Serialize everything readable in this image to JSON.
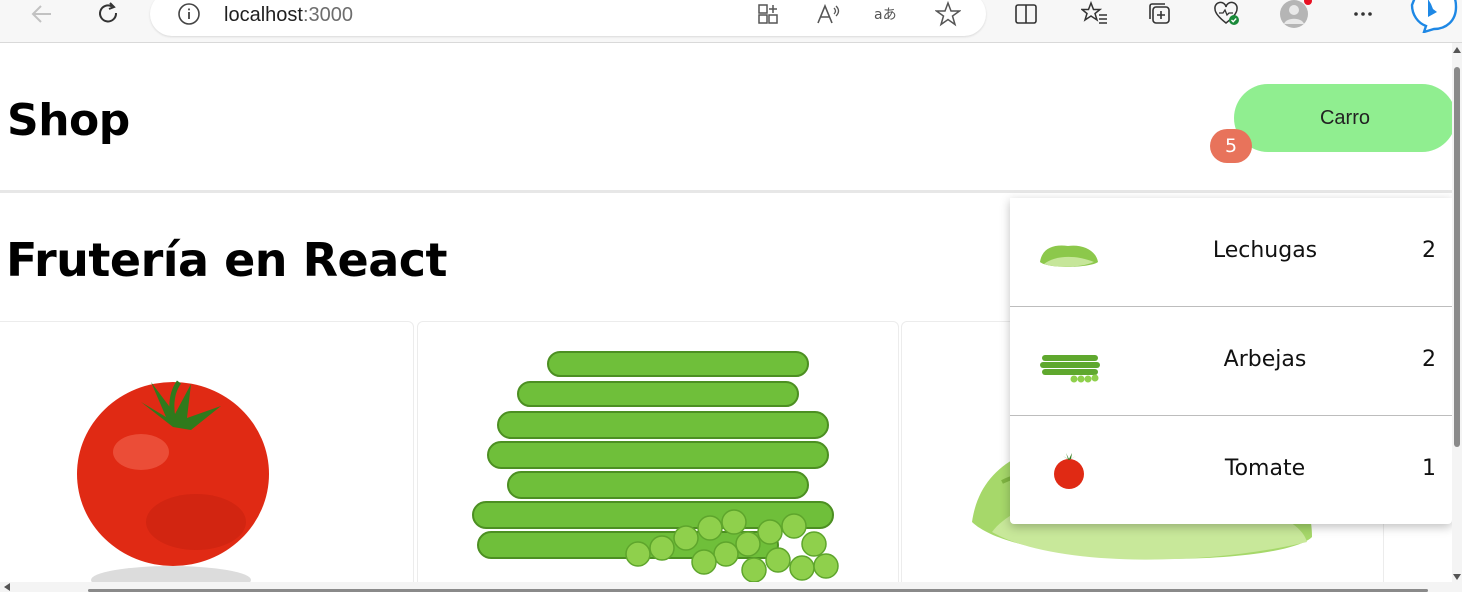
{
  "browser": {
    "url_host": "localhost",
    "url_port": ":3000"
  },
  "header": {
    "title": "Shop",
    "cart_button_label": "Carro",
    "cart_count": "5"
  },
  "main": {
    "title": "Frutería en React"
  },
  "cart": {
    "items": [
      {
        "name": "Lechugas",
        "qty": "2",
        "icon": "lettuce-thumbnail"
      },
      {
        "name": "Arbejas",
        "qty": "2",
        "icon": "peas-thumbnail"
      },
      {
        "name": "Tomate",
        "qty": "1",
        "icon": "tomato-thumbnail"
      }
    ]
  },
  "colors": {
    "cart_button": "#90ee90",
    "cart_badge": "#e8735b",
    "edge_accent": "#0c7ae0"
  }
}
